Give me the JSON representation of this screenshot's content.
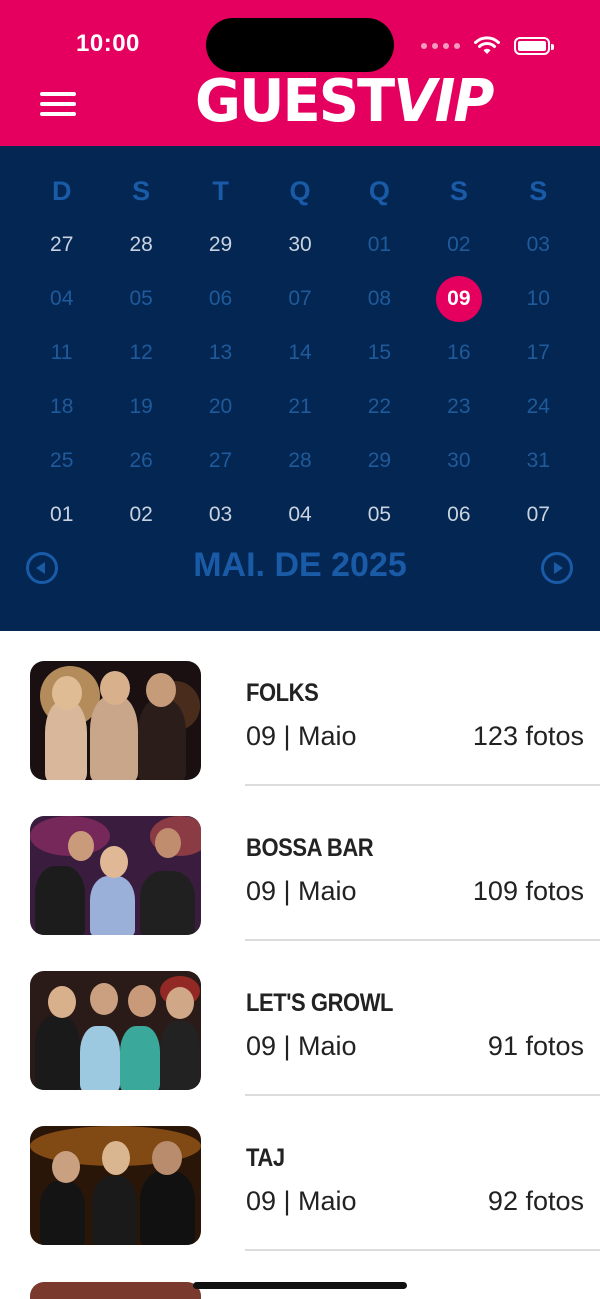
{
  "status_bar": {
    "time": "10:00"
  },
  "header": {
    "logo_main": "GUEST",
    "logo_accent": "VIP"
  },
  "calendar": {
    "weekdays": [
      "D",
      "S",
      "T",
      "Q",
      "Q",
      "S",
      "S"
    ],
    "weeks": [
      [
        "27",
        "28",
        "29",
        "30",
        "01",
        "02",
        "03"
      ],
      [
        "04",
        "05",
        "06",
        "07",
        "08",
        "09",
        "10"
      ],
      [
        "11",
        "12",
        "13",
        "14",
        "15",
        "16",
        "17"
      ],
      [
        "18",
        "19",
        "20",
        "21",
        "22",
        "23",
        "24"
      ],
      [
        "25",
        "26",
        "27",
        "28",
        "29",
        "30",
        "31"
      ],
      [
        "01",
        "02",
        "03",
        "04",
        "05",
        "06",
        "07"
      ]
    ],
    "selected_day": "09",
    "month_label": "MAI. DE 2025"
  },
  "events": [
    {
      "title": "FOLKS",
      "date": "09 | Maio",
      "count": "123 fotos"
    },
    {
      "title": "BOSSA BAR",
      "date": "09 | Maio",
      "count": "109 fotos"
    },
    {
      "title": "LET'S GROWL",
      "date": "09 | Maio",
      "count": "91 fotos"
    },
    {
      "title": "TAJ",
      "date": "09 | Maio",
      "count": "92 fotos"
    }
  ],
  "colors": {
    "brand_pink": "#e5005f",
    "calendar_bg": "#042653",
    "calendar_accent": "#1a5ba8"
  }
}
